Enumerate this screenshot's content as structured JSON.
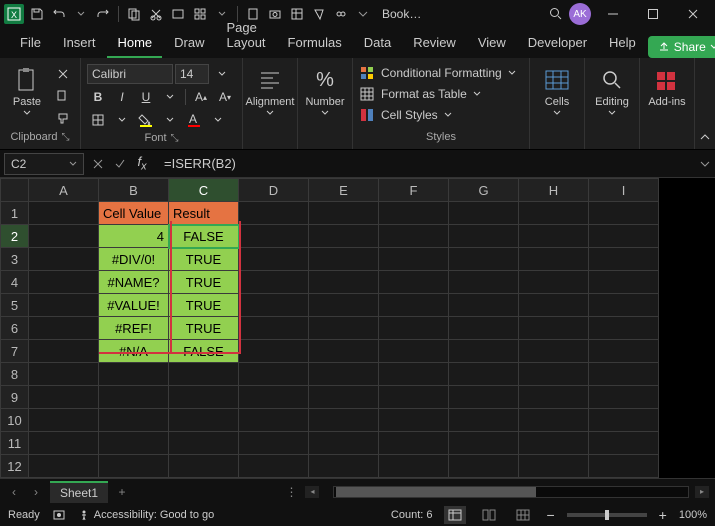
{
  "titlebar": {
    "doc_name": "Book…",
    "avatar": "AK"
  },
  "tabs": [
    "File",
    "Insert",
    "Home",
    "Draw",
    "Page Layout",
    "Formulas",
    "Data",
    "Review",
    "View",
    "Developer",
    "Help"
  ],
  "active_tab": "Home",
  "share_label": "Share",
  "ribbon": {
    "clipboard": {
      "paste": "Paste",
      "label": "Clipboard"
    },
    "font": {
      "name": "Calibri",
      "size": "14",
      "label": "Font"
    },
    "alignment": {
      "label": "Alignment"
    },
    "number": {
      "label": "Number"
    },
    "styles": {
      "cond_fmt": "Conditional Formatting",
      "fmt_table": "Format as Table",
      "cell_styles": "Cell Styles",
      "label": "Styles"
    },
    "cells": {
      "label": "Cells"
    },
    "editing": {
      "label": "Editing"
    },
    "addins": {
      "label": "Add-ins"
    }
  },
  "namebox": "C2",
  "formula": "=ISERR(B2)",
  "columns": [
    "A",
    "B",
    "C",
    "D",
    "E",
    "F",
    "G",
    "H",
    "I"
  ],
  "rows": [
    1,
    2,
    3,
    4,
    5,
    6,
    7,
    8,
    9,
    10,
    11,
    12
  ],
  "headers": {
    "b1": "Cell Value",
    "c1": "Result"
  },
  "data": {
    "b": [
      "4",
      "#DIV/0!",
      "#NAME?",
      "#VALUE!",
      "#REF!",
      "#N/A"
    ],
    "c": [
      "FALSE",
      "TRUE",
      "TRUE",
      "TRUE",
      "TRUE",
      "FALSE"
    ]
  },
  "sheet_tab": "Sheet1",
  "status": {
    "ready": "Ready",
    "acc": "Accessibility: Good to go",
    "count": "Count: 6",
    "zoom": "100%"
  },
  "chart_data": {
    "type": "table",
    "title": "ISERR function results",
    "columns": [
      "Cell Value",
      "Result"
    ],
    "rows": [
      [
        "4",
        "FALSE"
      ],
      [
        "#DIV/0!",
        "TRUE"
      ],
      [
        "#NAME?",
        "TRUE"
      ],
      [
        "#VALUE!",
        "TRUE"
      ],
      [
        "#REF!",
        "TRUE"
      ],
      [
        "#N/A",
        "FALSE"
      ]
    ]
  }
}
